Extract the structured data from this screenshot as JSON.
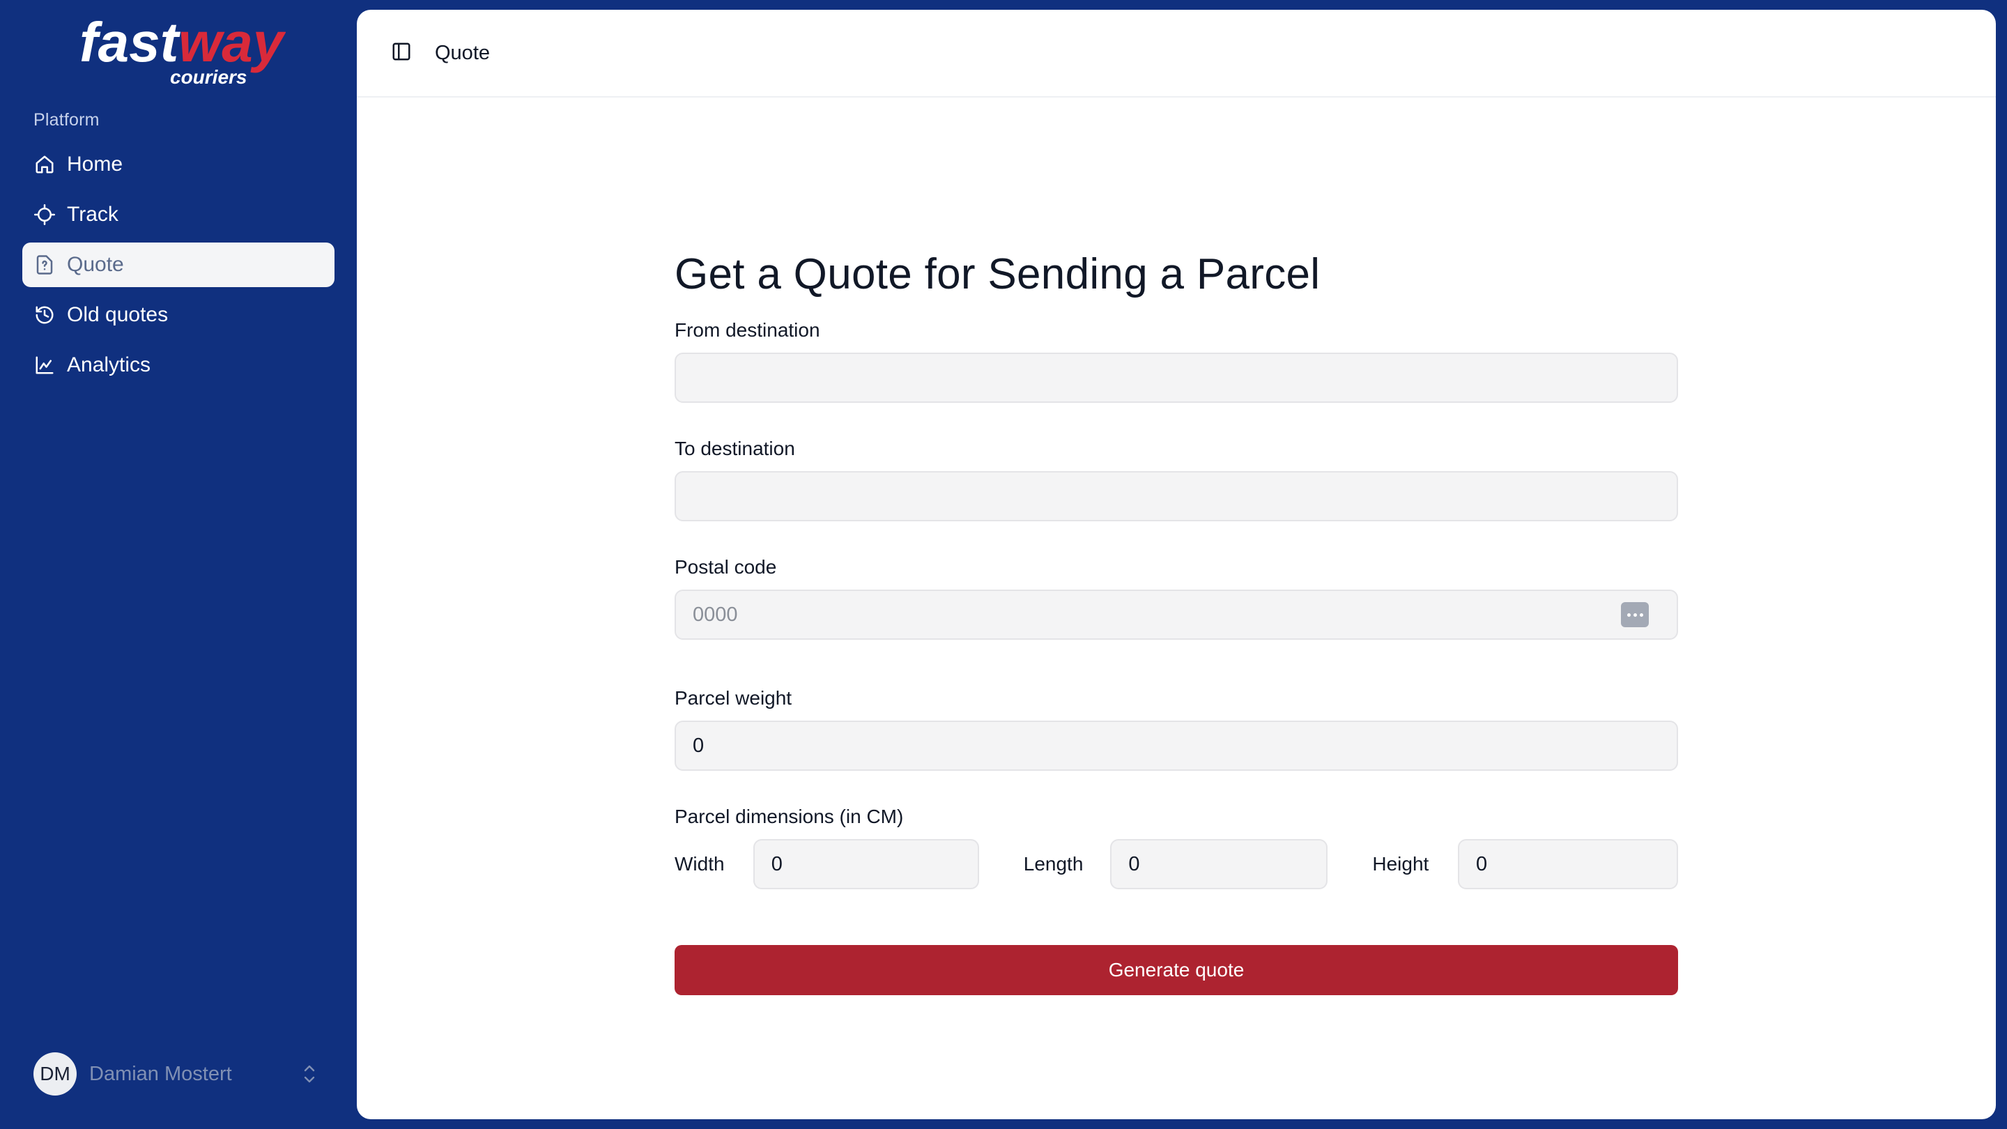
{
  "brand": {
    "logo_word_1": "fast",
    "logo_word_2": "way",
    "logo_sub": "couriers",
    "primary": "#10307f",
    "accent": "#ad2330"
  },
  "sidebar": {
    "section_label": "Platform",
    "items": [
      {
        "label": "Home",
        "icon": "home-icon"
      },
      {
        "label": "Track",
        "icon": "crosshair-icon"
      },
      {
        "label": "Quote",
        "icon": "file-question-icon",
        "active": true
      },
      {
        "label": "Old quotes",
        "icon": "history-icon"
      },
      {
        "label": "Analytics",
        "icon": "chart-icon"
      }
    ],
    "user": {
      "initials": "DM",
      "name": "Damian Mostert"
    }
  },
  "topbar": {
    "breadcrumb": "Quote"
  },
  "form": {
    "title": "Get a Quote for Sending a Parcel",
    "from": {
      "label": "From destination",
      "value": "",
      "placeholder": ""
    },
    "to": {
      "label": "To destination",
      "value": "",
      "placeholder": ""
    },
    "postal": {
      "label": "Postal code",
      "value": "",
      "placeholder": "0000"
    },
    "weight": {
      "label": "Parcel weight",
      "value": "0"
    },
    "dimensions": {
      "label": "Parcel dimensions (in CM)",
      "width": {
        "label": "Width",
        "value": "0"
      },
      "length": {
        "label": "Length",
        "value": "0"
      },
      "height": {
        "label": "Height",
        "value": "0"
      }
    },
    "submit_label": "Generate quote"
  }
}
